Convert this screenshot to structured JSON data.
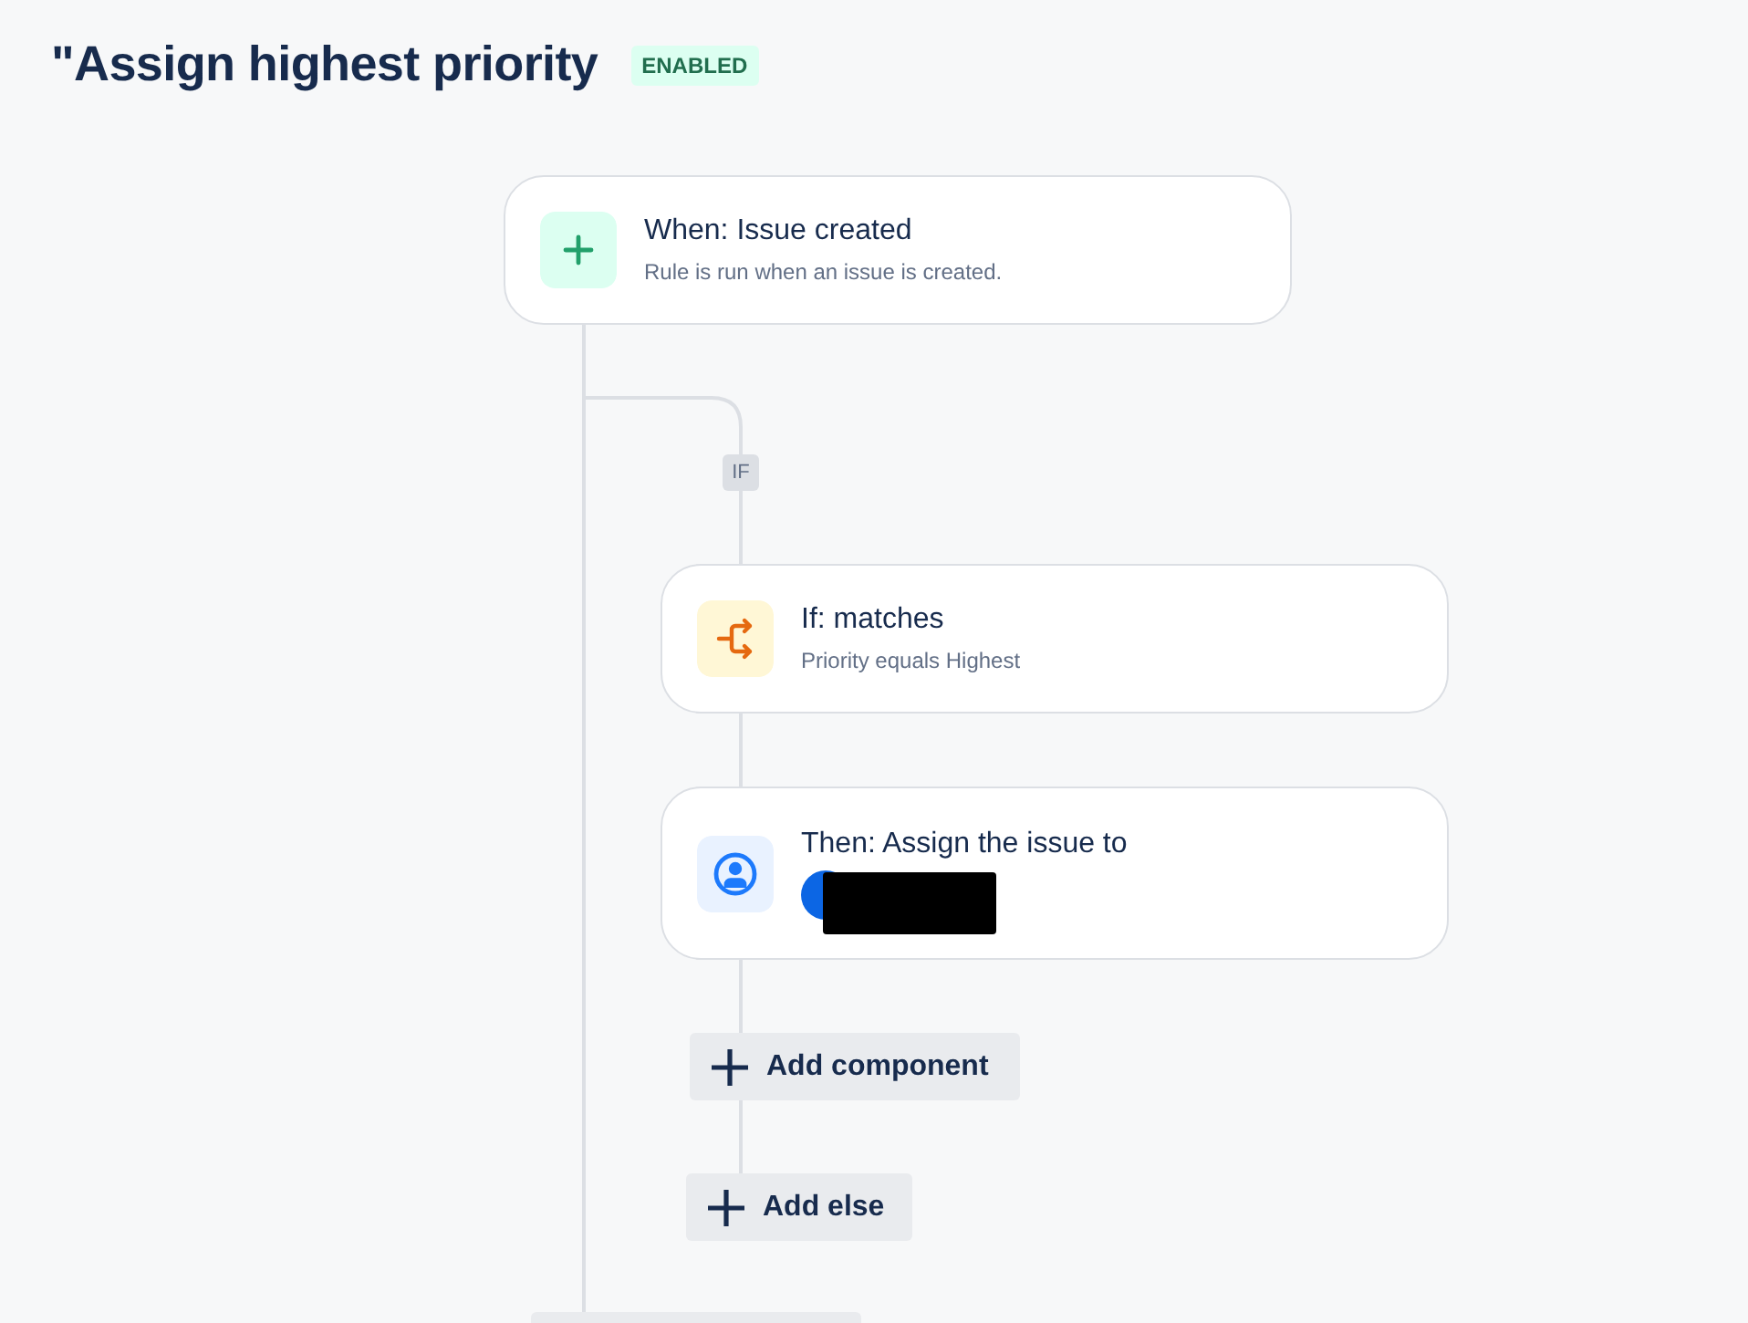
{
  "header": {
    "title": "\"Assign highest priority",
    "status": {
      "label": "ENABLED",
      "kind": "enabled"
    }
  },
  "nodes": [
    {
      "kind": "trigger",
      "title": "When: Issue created",
      "description": "Rule is run when an issue is created."
    },
    {
      "kind": "condition",
      "branch_label": "IF",
      "title": "If: matches",
      "description": "Priority equals Highest"
    },
    {
      "kind": "action",
      "title": "Then: Assign the issue to",
      "assignee": {
        "redacted": true
      }
    }
  ],
  "buttons": [
    {
      "label": "Add component"
    },
    {
      "label": "Add else"
    }
  ]
}
